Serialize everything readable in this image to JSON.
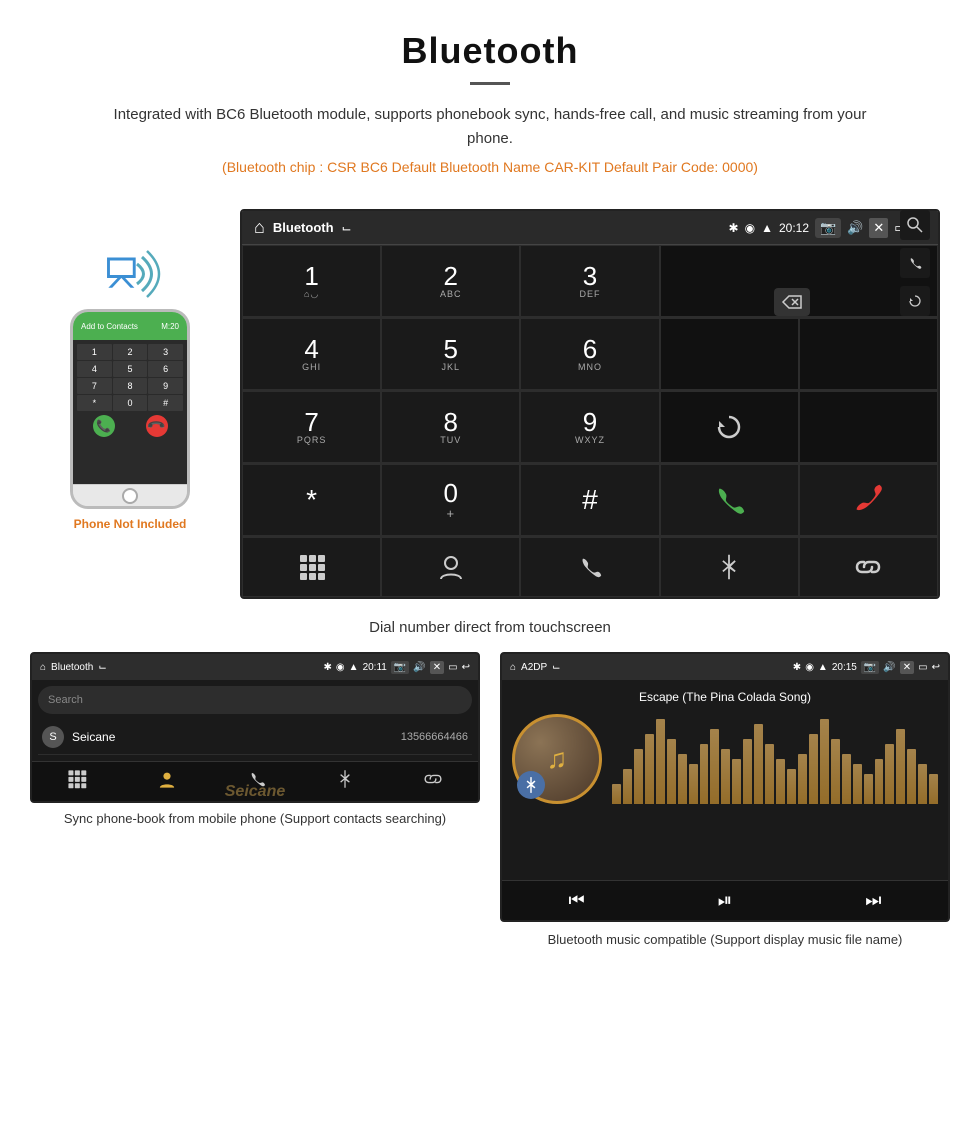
{
  "header": {
    "title": "Bluetooth",
    "description": "Integrated with BC6 Bluetooth module, supports phonebook sync, hands-free call, and music streaming from your phone.",
    "specs": "(Bluetooth chip : CSR BC6   Default Bluetooth Name CAR-KIT    Default Pair Code: 0000)"
  },
  "phone_mockup": {
    "not_included_label": "Phone Not Included",
    "top_bar_text": "M:20"
  },
  "dial_screen": {
    "status_bar": {
      "title": "Bluetooth",
      "time": "20:12"
    },
    "keys": [
      {
        "main": "1",
        "sub": "⌂◡"
      },
      {
        "main": "2",
        "sub": "ABC"
      },
      {
        "main": "3",
        "sub": "DEF"
      },
      {
        "main": "",
        "sub": ""
      },
      {
        "main": "⌫",
        "sub": ""
      },
      {
        "main": "4",
        "sub": "GHI"
      },
      {
        "main": "5",
        "sub": "JKL"
      },
      {
        "main": "6",
        "sub": "MNO"
      },
      {
        "main": "",
        "sub": ""
      },
      {
        "main": "",
        "sub": ""
      },
      {
        "main": "7",
        "sub": "PQRS"
      },
      {
        "main": "8",
        "sub": "TUV"
      },
      {
        "main": "9",
        "sub": "WXYZ"
      },
      {
        "main": "↻",
        "sub": ""
      },
      {
        "main": "",
        "sub": ""
      },
      {
        "main": "*",
        "sub": ""
      },
      {
        "main": "0",
        "sub": "+"
      },
      {
        "main": "#",
        "sub": ""
      },
      {
        "main": "📞",
        "sub": ""
      },
      {
        "main": "📞end",
        "sub": ""
      }
    ],
    "bottom_icons": [
      "⣿",
      "👤",
      "📞",
      "✱",
      "🔗"
    ]
  },
  "main_caption": "Dial number direct from touchscreen",
  "contacts_screen": {
    "status_bar": {
      "left": "Bluetooth",
      "time": "20:11"
    },
    "search_placeholder": "Search",
    "contacts": [
      {
        "letter": "S",
        "name": "Seicane",
        "number": "13566664466"
      }
    ],
    "bottom_icons": [
      "⣿",
      "👤",
      "📞",
      "✱",
      "🔗"
    ]
  },
  "music_screen": {
    "status_bar": {
      "left": "A2DP",
      "time": "20:15"
    },
    "song_title": "Escape (The Pina Colada Song)",
    "bottom_icons": [
      "⏮",
      "⏯",
      "⏭"
    ]
  },
  "captions": {
    "left": "Sync phone-book from mobile phone\n(Support contacts searching)",
    "right": "Bluetooth music compatible\n(Support display music file name)"
  },
  "eq_bars": [
    20,
    35,
    55,
    70,
    85,
    65,
    50,
    40,
    60,
    75,
    55,
    45,
    65,
    80,
    60,
    45,
    35,
    50,
    70,
    85,
    65,
    50,
    40,
    30,
    45,
    60,
    75,
    55,
    40,
    30
  ]
}
